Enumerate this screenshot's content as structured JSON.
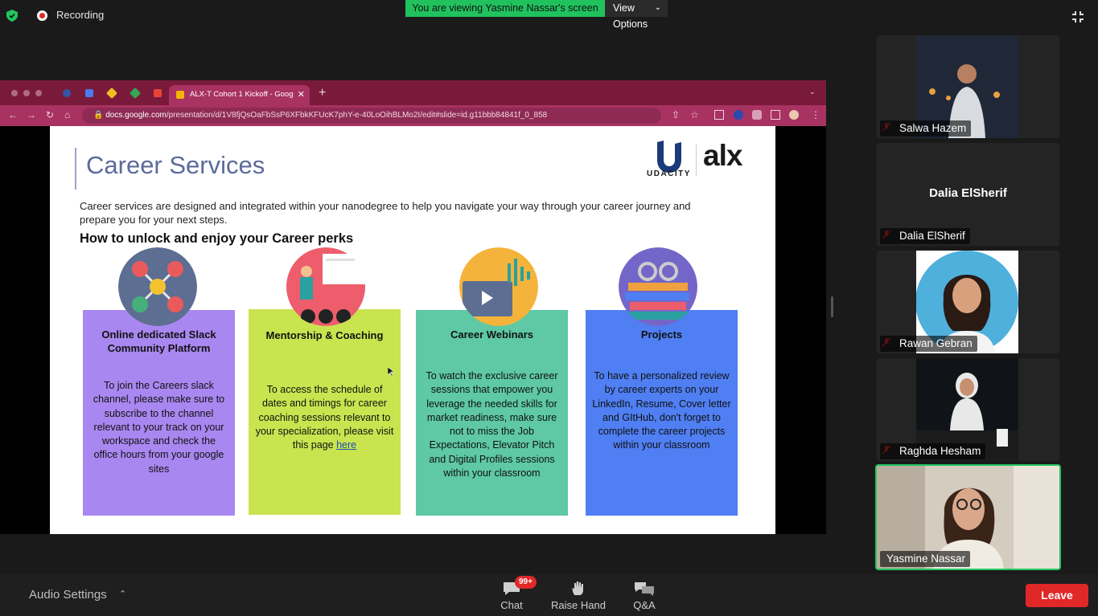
{
  "top_bar": {
    "recording_label": "Recording",
    "viewing_banner": "You are viewing Yasmine Nassar's screen",
    "view_options_label": "View Options",
    "exit_fullscreen_icon": "exit-fullscreen-icon"
  },
  "browser": {
    "active_tab_title": "ALX-T Cohort 1 Kickoff - Goog",
    "url_host": "docs.google.com",
    "url_path": "/presentation/d/1V8fjQsOaFbSsP6XFbkKFUcK7phY-e-40LoOihBLMo2I/edit#slide=id.g11bbb84841f_0_858",
    "accent_color": "#a83262"
  },
  "slide": {
    "title": "Career Services",
    "logo_udacity": "UDACITY",
    "logo_alx": "alx",
    "intro": "Career services are designed and integrated within your nanodegree to help you navigate your way through your career journey and prepare you for your next steps.",
    "subtitle": "How to unlock and enjoy your Career perks",
    "cards": [
      {
        "title": "Online dedicated Slack Community Platform",
        "body": "To join the Careers slack channel, please make sure to subscribe to the channel relevant to your track on your workspace and check the office hours from your google sites",
        "color": "#a987f0"
      },
      {
        "title": "Mentorship & Coaching",
        "body": "To access the schedule of dates and timings for career coaching sessions relevant to your specialization, please visit this page",
        "link": "here",
        "color": "#c9e44f"
      },
      {
        "title": "Career Webinars",
        "body": "To watch the exclusive career sessions that empower you leverage the needed skills for market readiness, make sure not to miss the Job Expectations, Elevator Pitch and Digital Profiles sessions within your classroom",
        "color": "#5ec9a4"
      },
      {
        "title": "Projects",
        "body": "To have a personalized review by career experts on your LinkedIn, Resume, Cover letter and GItHub, don't forget to complete the career projects within your classroom",
        "color": "#4f7ff2"
      }
    ]
  },
  "participants": [
    {
      "name": "Salwa Hazem",
      "muted": true
    },
    {
      "name": "Dalia ElSherif",
      "muted": true,
      "video_off": true
    },
    {
      "name": "Rawan Gebran",
      "muted": true
    },
    {
      "name": "Raghda Hesham",
      "muted": true
    },
    {
      "name": "Yasmine Nassar",
      "active_speaker": true
    }
  ],
  "bottom_bar": {
    "audio_settings_label": "Audio Settings",
    "chat_label": "Chat",
    "chat_badge": "99+",
    "raise_hand_label": "Raise Hand",
    "qa_label": "Q&A",
    "leave_label": "Leave"
  }
}
